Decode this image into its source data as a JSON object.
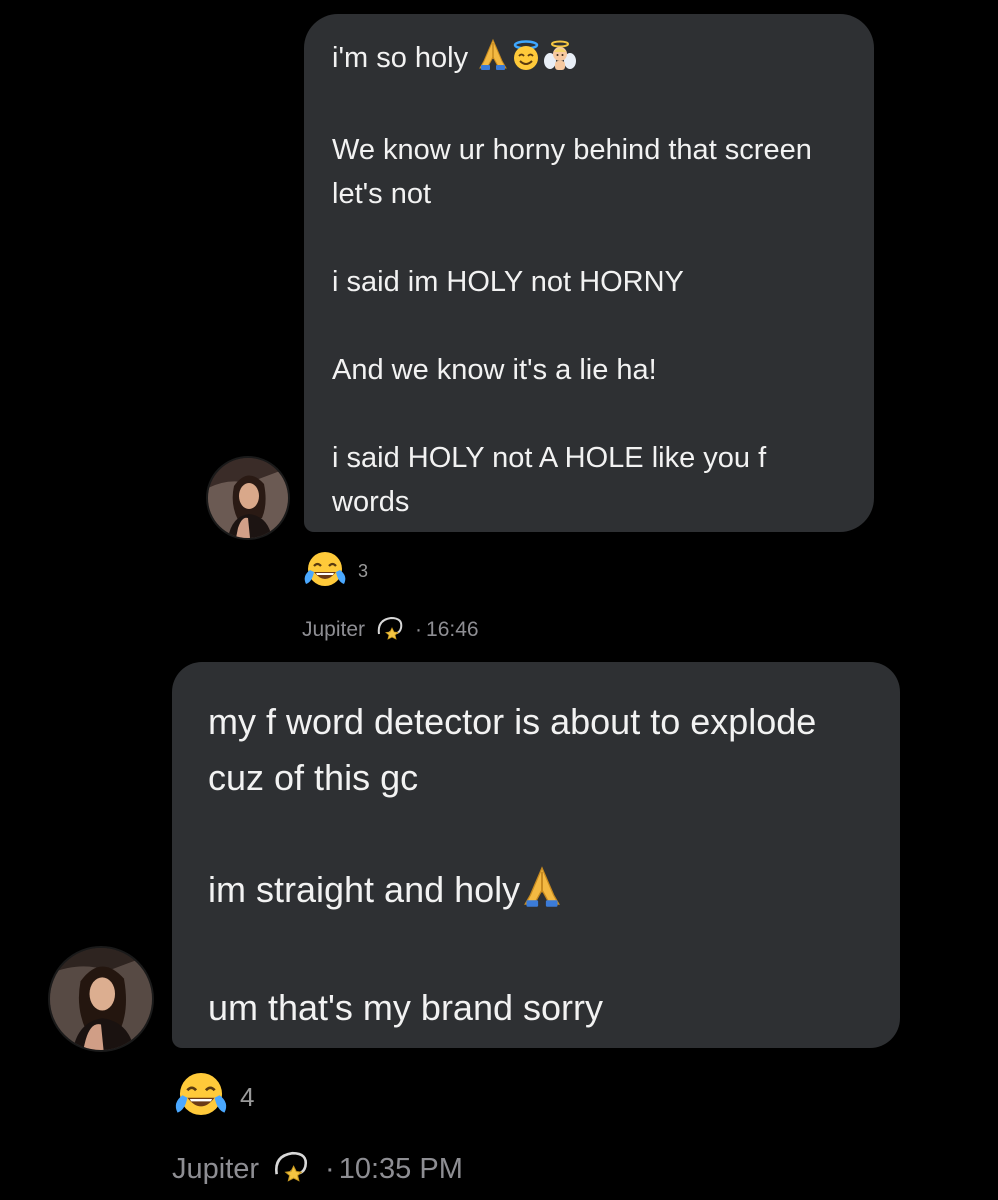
{
  "messages": [
    {
      "lines": [
        "i'm so holy",
        "We know ur horny behind that screen let's not",
        "i said im HOLY not HORNY",
        "And we know it's a lie ha!",
        "i said HOLY not A HOLE like you f words"
      ],
      "first_line_emoji": [
        "folded-hands-icon",
        "smiling-face-with-halo-icon",
        "baby-angel-icon"
      ],
      "reaction": {
        "emoji": "face-with-tears-of-joy-icon",
        "count": "3"
      },
      "meta": {
        "sender": "Jupiter",
        "sender_emoji": "dizzy-star-icon",
        "separator": "·",
        "time": "16:46"
      }
    },
    {
      "lines": [
        "my f word detector is about to explode cuz of this gc",
        "im straight and holy",
        "um that's my brand sorry"
      ],
      "second_line_emoji": [
        "folded-hands-icon"
      ],
      "reaction": {
        "emoji": "face-with-tears-of-joy-icon",
        "count": "4"
      },
      "meta": {
        "sender": "Jupiter",
        "sender_emoji": "dizzy-star-icon",
        "separator": "·",
        "time": "10:35 PM"
      }
    }
  ],
  "colors": {
    "background": "#000000",
    "bubble": "#2e3033",
    "text": "#f2f2f2",
    "meta": "#8e8e93"
  }
}
